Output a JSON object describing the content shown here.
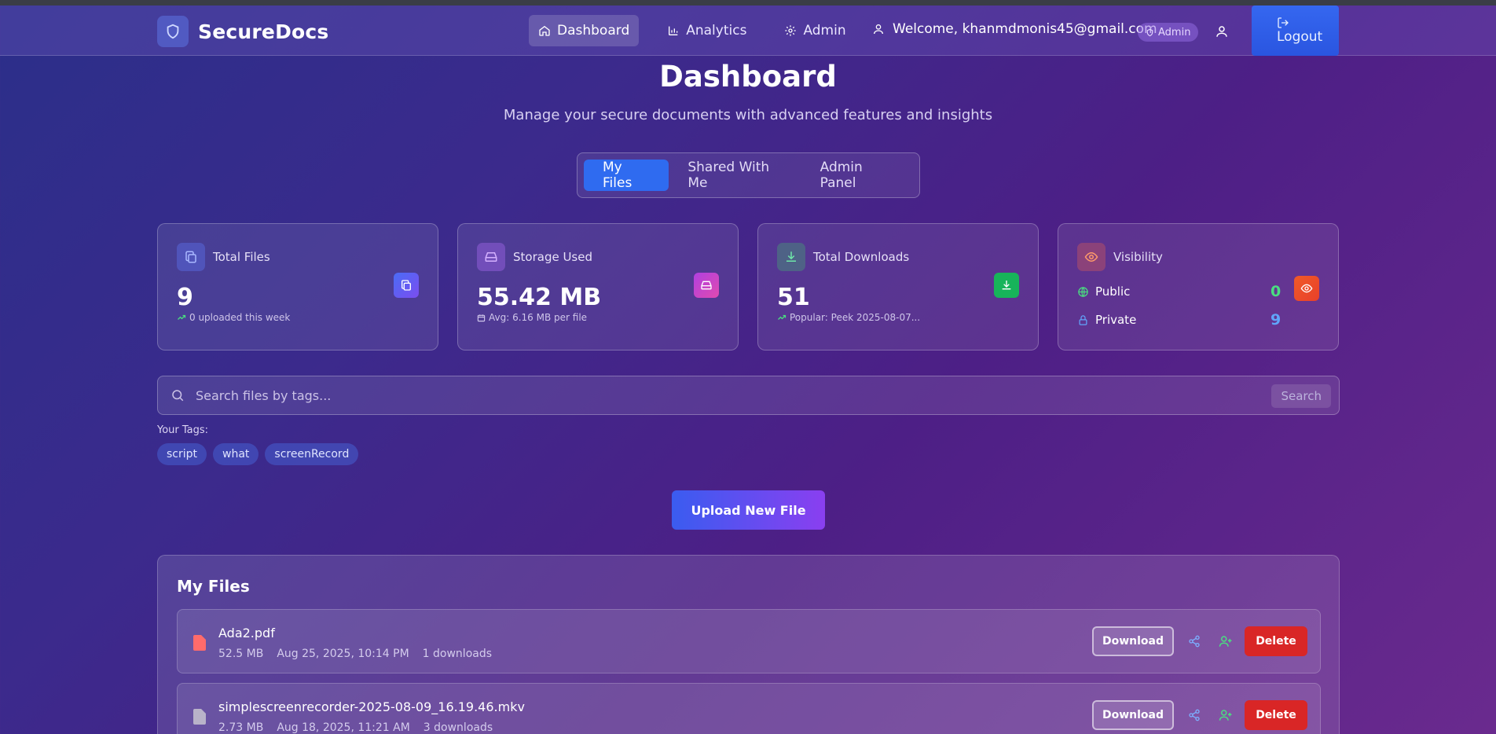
{
  "app": {
    "name": "SecureDocs"
  },
  "nav": {
    "links": [
      {
        "label": "Dashboard",
        "icon": "home-icon",
        "active": true
      },
      {
        "label": "Analytics",
        "icon": "bar-chart-icon",
        "active": false
      },
      {
        "label": "Admin",
        "icon": "gear-icon",
        "active": false
      }
    ],
    "welcome": "Welcome, khanmdmonis45@gmail.com",
    "role_badge": "Admin",
    "logout": "Logout"
  },
  "header": {
    "title": "Dashboard",
    "subtitle": "Manage your secure documents with advanced features and insights"
  },
  "tabs": [
    {
      "label": "My Files",
      "active": true
    },
    {
      "label": "Shared With Me",
      "active": false
    },
    {
      "label": "Admin Panel",
      "active": false
    }
  ],
  "stats": {
    "total_files": {
      "label": "Total Files",
      "value": "9",
      "note": "0 uploaded this week"
    },
    "storage": {
      "label": "Storage Used",
      "value": "55.42 MB",
      "note": "Avg: 6.16 MB per file"
    },
    "downloads": {
      "label": "Total Downloads",
      "value": "51",
      "note": "Popular: Peek 2025-08-07..."
    },
    "visibility": {
      "label": "Visibility",
      "public_label": "Public",
      "public_value": "0",
      "private_label": "Private",
      "private_value": "9"
    }
  },
  "search": {
    "placeholder": "Search files by tags...",
    "button": "Search"
  },
  "tags": {
    "label": "Your Tags:",
    "items": [
      "script",
      "what",
      "screenRecord"
    ]
  },
  "upload": {
    "label": "Upload New File"
  },
  "files": {
    "title": "My Files",
    "download_label": "Download",
    "delete_label": "Delete",
    "rows": [
      {
        "name": "Ada2.pdf",
        "size": "52.5 MB",
        "date": "Aug 25, 2025, 10:14 PM",
        "downloads": "1 downloads",
        "icon_color": "#ff6b6b"
      },
      {
        "name": "simplescreenrecorder-2025-08-09_16.19.46.mkv",
        "size": "2.73 MB",
        "date": "Aug 18, 2025, 11:21 AM",
        "downloads": "3 downloads",
        "icon_color": "#b9b3c9"
      }
    ]
  },
  "colors": {
    "accent": "#2f6bf0",
    "danger": "#d92626",
    "public": "#4ade80",
    "private": "#60a5fa"
  }
}
